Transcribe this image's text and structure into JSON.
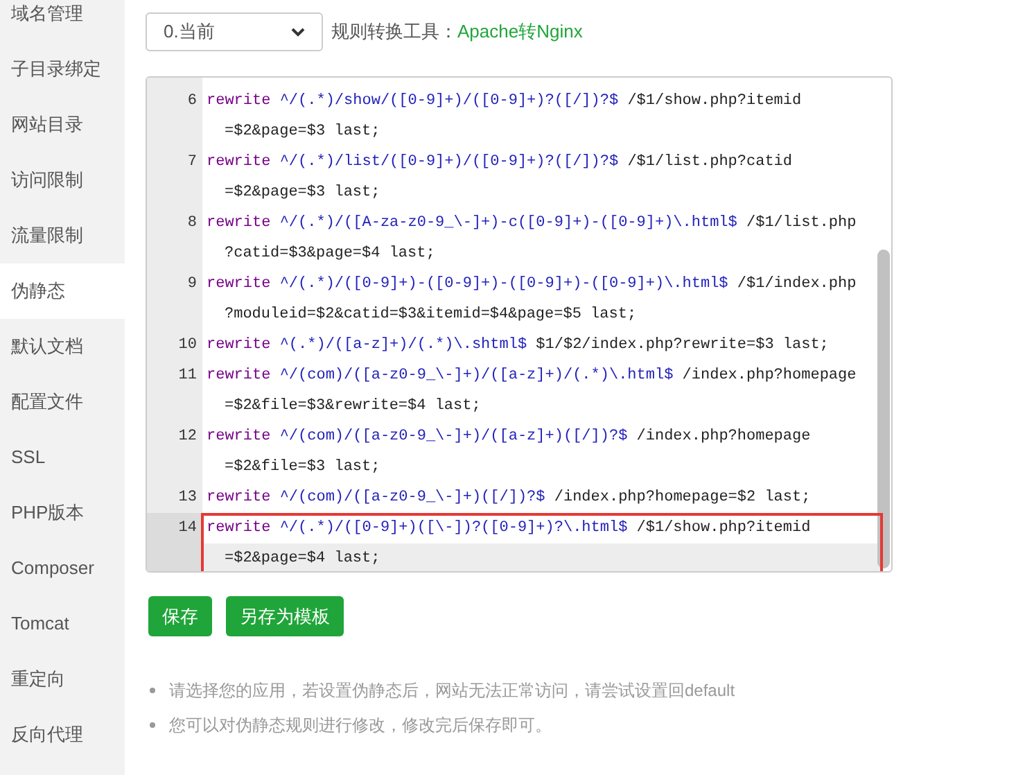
{
  "sidebar": {
    "items": [
      {
        "label": "域名管理",
        "selected": false
      },
      {
        "label": "子目录绑定",
        "selected": false
      },
      {
        "label": "网站目录",
        "selected": false
      },
      {
        "label": "访问限制",
        "selected": false
      },
      {
        "label": "流量限制",
        "selected": false
      },
      {
        "label": "伪静态",
        "selected": true
      },
      {
        "label": "默认文档",
        "selected": false
      },
      {
        "label": "配置文件",
        "selected": false
      },
      {
        "label": "SSL",
        "selected": false
      },
      {
        "label": "PHP版本",
        "selected": false
      },
      {
        "label": "Composer",
        "selected": false
      },
      {
        "label": "Tomcat",
        "selected": false
      },
      {
        "label": "重定向",
        "selected": false
      },
      {
        "label": "反向代理",
        "selected": false
      }
    ]
  },
  "version_select": {
    "value": "0.当前"
  },
  "converter": {
    "label": "规则转换工具：",
    "link": "Apache转Nginx"
  },
  "editor": {
    "lines": [
      {
        "number": "6",
        "keyword": "rewrite",
        "pattern": "^/(.*)/show/([0-9]+)/([0-9]+)?([/])?$",
        "target": "/$1/show.php?itemid",
        "continuation": "=$2&page=$3 last;",
        "highlighted": false
      },
      {
        "number": "7",
        "keyword": "rewrite",
        "pattern": "^/(.*)/list/([0-9]+)/([0-9]+)?([/])?$",
        "target": "/$1/list.php?catid",
        "continuation": "=$2&page=$3 last;",
        "highlighted": false
      },
      {
        "number": "8",
        "keyword": "rewrite",
        "pattern": "^/(.*)/([A-za-z0-9_\\-]+)-c([0-9]+)-([0-9]+)\\.html$",
        "target": "/$1/list.php",
        "continuation": "?catid=$3&page=$4 last;",
        "highlighted": false
      },
      {
        "number": "9",
        "keyword": "rewrite",
        "pattern": "^/(.*)/([0-9]+)-([0-9]+)-([0-9]+)-([0-9]+)\\.html$",
        "target": "/$1/index.php",
        "continuation": "?moduleid=$2&catid=$3&itemid=$4&page=$5 last;",
        "highlighted": false
      },
      {
        "number": "10",
        "keyword": "rewrite",
        "pattern": "^(.*)/([a-z]+)/(.*)\\.shtml$",
        "target": "$1/$2/index.php?rewrite=$3 last;",
        "highlighted": false
      },
      {
        "number": "11",
        "keyword": "rewrite",
        "pattern": "^/(com)/([a-z0-9_\\-]+)/([a-z]+)/(.*)\\.html$",
        "target": "/index.php?homepage",
        "continuation": "=$2&file=$3&rewrite=$4 last;",
        "highlighted": false
      },
      {
        "number": "12",
        "keyword": "rewrite",
        "pattern": "^/(com)/([a-z0-9_\\-]+)/([a-z]+)([/])?$",
        "target": "/index.php?homepage",
        "continuation": "=$2&file=$3 last;",
        "highlighted": false
      },
      {
        "number": "13",
        "keyword": "rewrite",
        "pattern": "^/(com)/([a-z0-9_\\-]+)([/])?$",
        "target": "/index.php?homepage=$2 last;",
        "highlighted": false
      },
      {
        "number": "14",
        "keyword": "rewrite",
        "pattern": "^/(.*)/([0-9]+)([\\-])?([0-9]+)?\\.html$",
        "target": "/$1/show.php?itemid",
        "continuation": "=$2&page=$4 last;",
        "highlighted": true
      }
    ]
  },
  "buttons": [
    {
      "label": "保存"
    },
    {
      "label": "另存为模板"
    }
  ],
  "notes": [
    "请选择您的应用，若设置伪静态后，网站无法正常访问，请尝试设置回default",
    "您可以对伪静态规则进行修改，修改完后保存即可。"
  ]
}
